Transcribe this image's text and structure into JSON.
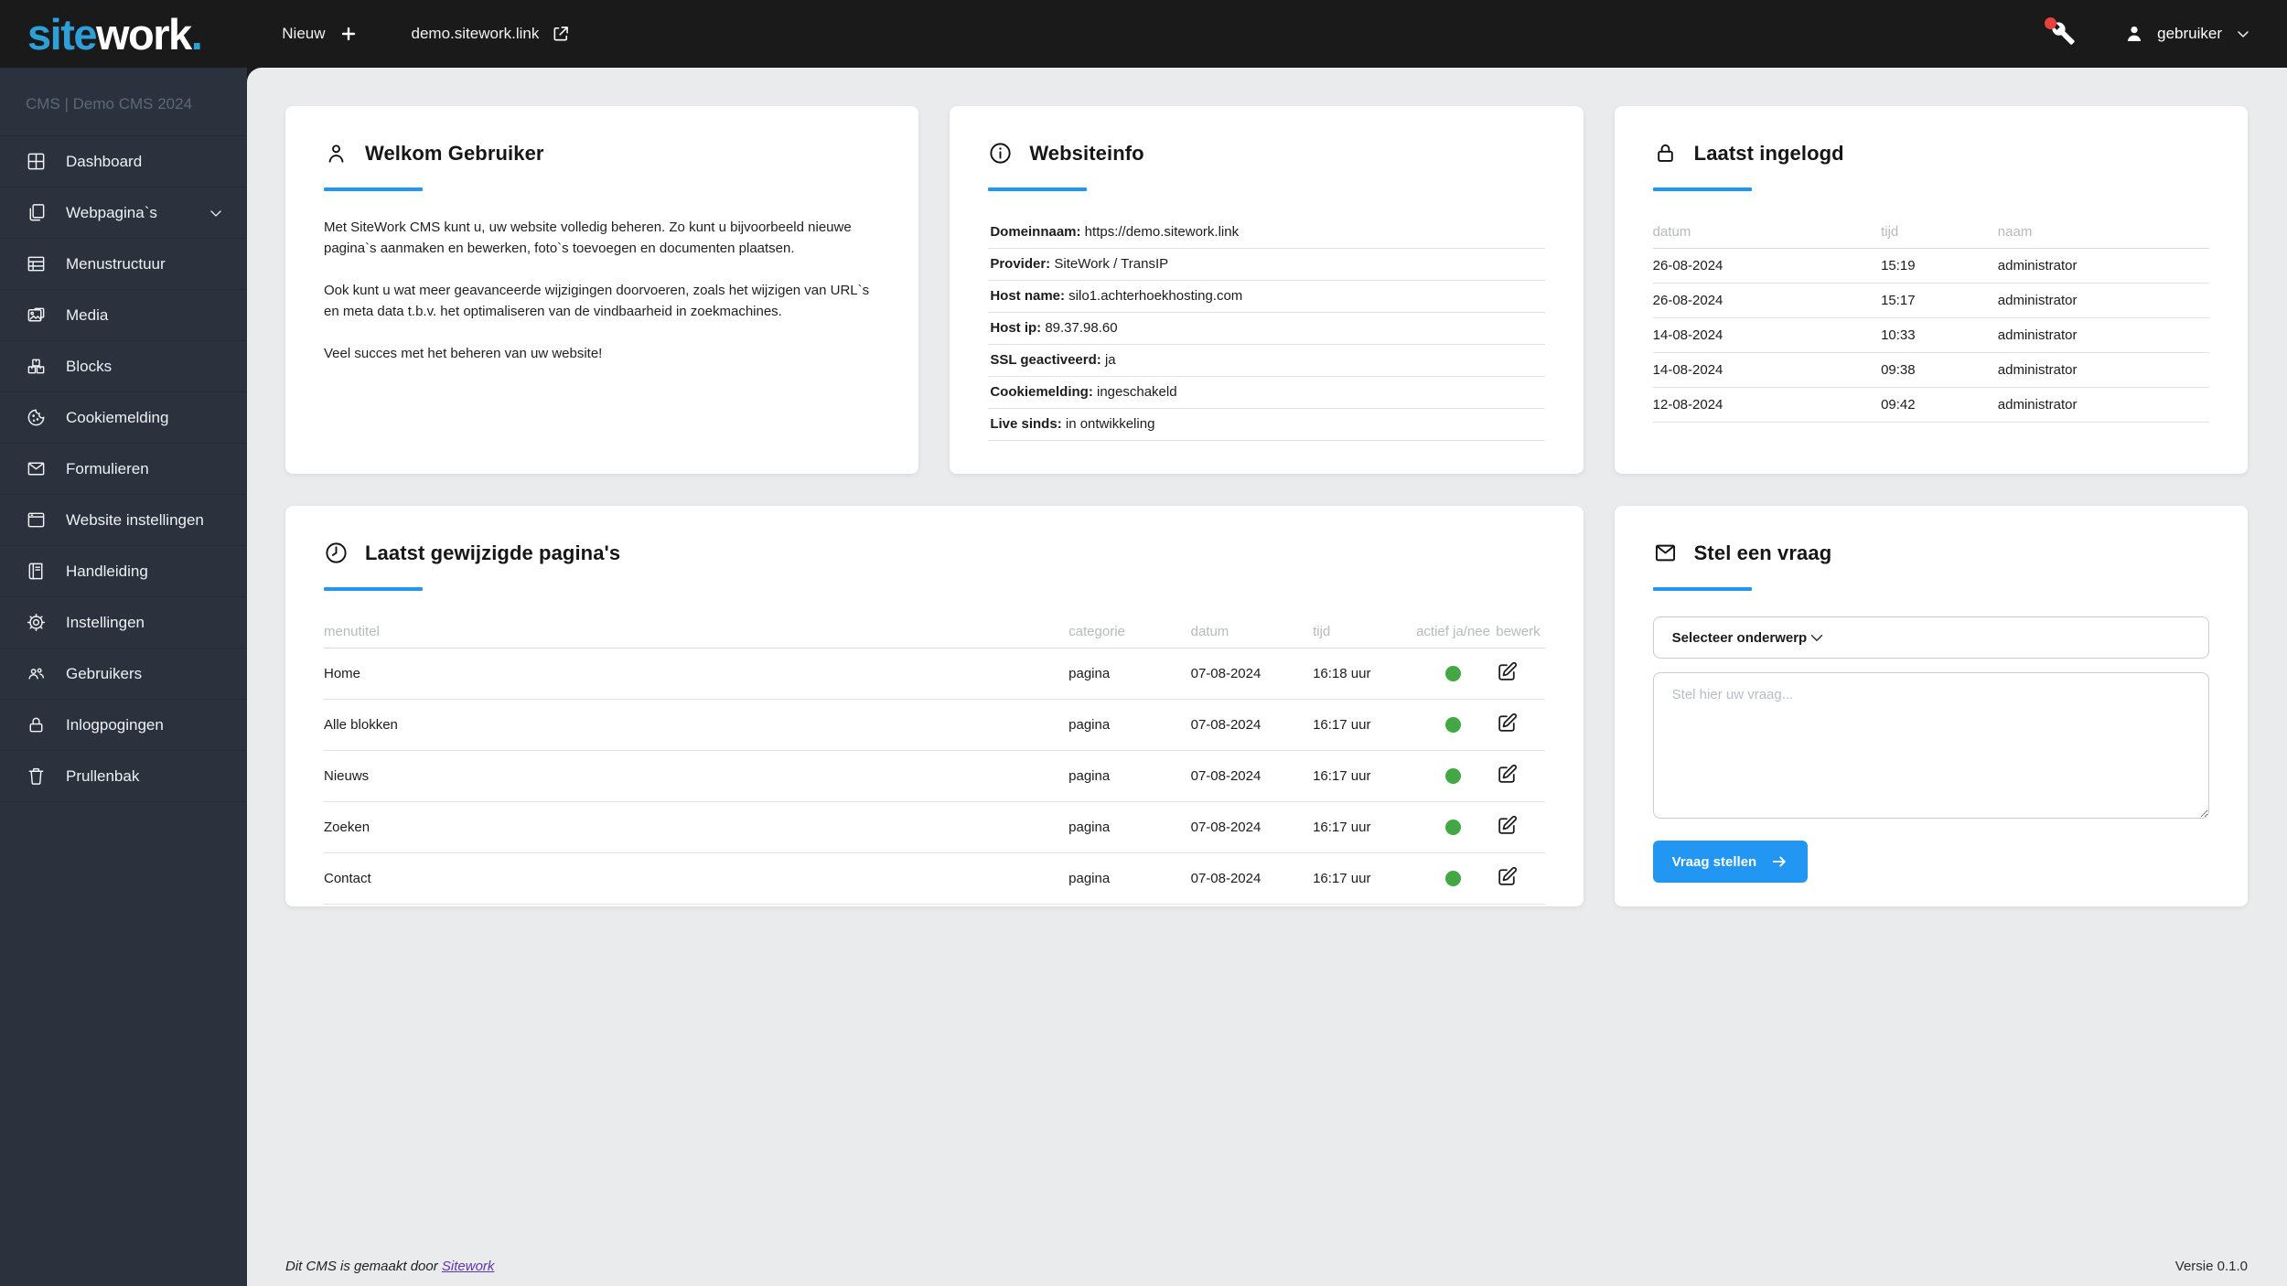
{
  "topbar": {
    "logo": {
      "part1": "site",
      "part2": "work",
      "part3": "."
    },
    "new_label": "Nieuw",
    "site_link": "demo.sitework.link",
    "user_label": "gebruiker"
  },
  "sidebar": {
    "header": "CMS | Demo CMS 2024",
    "items": [
      {
        "label": "Dashboard",
        "icon": "dashboard-icon"
      },
      {
        "label": "Webpagina`s",
        "icon": "pages-icon",
        "expandable": true
      },
      {
        "label": "Menustructuur",
        "icon": "menu-structure-icon"
      },
      {
        "label": "Media",
        "icon": "media-icon"
      },
      {
        "label": "Blocks",
        "icon": "blocks-icon"
      },
      {
        "label": "Cookiemelding",
        "icon": "cookie-icon"
      },
      {
        "label": "Formulieren",
        "icon": "envelope-icon"
      },
      {
        "label": "Website instellingen",
        "icon": "browser-icon"
      },
      {
        "label": "Handleiding",
        "icon": "book-icon"
      },
      {
        "label": "Instellingen",
        "icon": "gear-icon"
      },
      {
        "label": "Gebruikers",
        "icon": "users-icon"
      },
      {
        "label": "Inlogpogingen",
        "icon": "lock-icon"
      },
      {
        "label": "Prullenbak",
        "icon": "trash-icon"
      }
    ]
  },
  "cards": {
    "welcome": {
      "title": "Welkom Gebruiker",
      "icon": "user-outline-icon",
      "paragraphs": [
        "Met SiteWork CMS kunt u, uw website volledig beheren. Zo kunt u bijvoorbeeld nieuwe pagina`s aanmaken en bewerken, foto`s toevoegen en documenten plaatsen.",
        "Ook kunt u wat meer geavanceerde wijzigingen doorvoeren, zoals het wijzigen van URL`s en meta data t.b.v. het optimaliseren van de vindbaarheid in zoekmachines.",
        "Veel succes met het beheren van uw website!"
      ]
    },
    "websiteinfo": {
      "title": "Websiteinfo",
      "icon": "info-icon",
      "rows": [
        {
          "label": "Domeinnaam:",
          "value": " https://demo.sitework.link"
        },
        {
          "label": "Provider:",
          "value": " SiteWork / TransIP"
        },
        {
          "label": "Host name:",
          "value": " silo1.achterhoekhosting.com"
        },
        {
          "label": "Host ip:",
          "value": " 89.37.98.60"
        },
        {
          "label": "SSL geactiveerd:",
          "value": " ja"
        },
        {
          "label": "Cookiemelding:",
          "value": " ingeschakeld"
        },
        {
          "label": "Live sinds:",
          "value": " in ontwikkeling"
        }
      ]
    },
    "last_login": {
      "title": "Laatst ingelogd",
      "icon": "lock-icon",
      "columns": {
        "datum": "datum",
        "tijd": "tijd",
        "naam": "naam"
      },
      "rows": [
        {
          "datum": "26-08-2024",
          "tijd": "15:19",
          "naam": "administrator"
        },
        {
          "datum": "26-08-2024",
          "tijd": "15:17",
          "naam": "administrator"
        },
        {
          "datum": "14-08-2024",
          "tijd": "10:33",
          "naam": "administrator"
        },
        {
          "datum": "14-08-2024",
          "tijd": "09:38",
          "naam": "administrator"
        },
        {
          "datum": "12-08-2024",
          "tijd": "09:42",
          "naam": "administrator"
        }
      ]
    },
    "last_modified": {
      "title": "Laatst gewijzigde pagina's",
      "icon": "clock-icon",
      "columns": {
        "menutitel": "menutitel",
        "categorie": "categorie",
        "datum": "datum",
        "tijd": "tijd",
        "actief": "actief ja/nee",
        "bewerk": "bewerk"
      },
      "rows": [
        {
          "menutitel": "Home",
          "categorie": "pagina",
          "datum": "07-08-2024",
          "tijd": "16:18 uur",
          "actief": "ja"
        },
        {
          "menutitel": "Alle blokken",
          "categorie": "pagina",
          "datum": "07-08-2024",
          "tijd": "16:17 uur",
          "actief": "ja"
        },
        {
          "menutitel": "Nieuws",
          "categorie": "pagina",
          "datum": "07-08-2024",
          "tijd": "16:17 uur",
          "actief": "ja"
        },
        {
          "menutitel": "Zoeken",
          "categorie": "pagina",
          "datum": "07-08-2024",
          "tijd": "16:17 uur",
          "actief": "ja"
        },
        {
          "menutitel": "Contact",
          "categorie": "pagina",
          "datum": "07-08-2024",
          "tijd": "16:17 uur",
          "actief": "ja"
        }
      ]
    },
    "ask_question": {
      "title": "Stel een vraag",
      "icon": "envelope-icon",
      "select_value": "Selecteer onderwerp",
      "textarea_placeholder": "Stel hier uw vraag...",
      "submit_label": "Vraag stellen"
    }
  },
  "footer": {
    "credit_prefix": "Dit CMS is gemaakt door ",
    "credit_link": "Sitework",
    "version": "Versie 0.1.0"
  },
  "colors": {
    "accent_blue": "#2196f3",
    "logo_blue": "#2f9fd8",
    "topbar_bg": "#1a1a1a",
    "sidebar_bg": "#2b323d",
    "content_bg": "#e9ebed",
    "active_green": "#43a843",
    "notification_red": "#e8413c",
    "link_purple": "#5e35b1"
  },
  "icons": {
    "wrench-icon": "wrench with red notification dot",
    "user-filled-icon": "filled person silhouette",
    "chevron-down-icon": "chevron pointing down",
    "plus-icon": "plus sign",
    "external-link-icon": "box with outgoing arrow",
    "edit-icon": "pencil over square",
    "arrow-right-icon": "right arrow",
    "active-status-dot": "green circle = page active"
  }
}
